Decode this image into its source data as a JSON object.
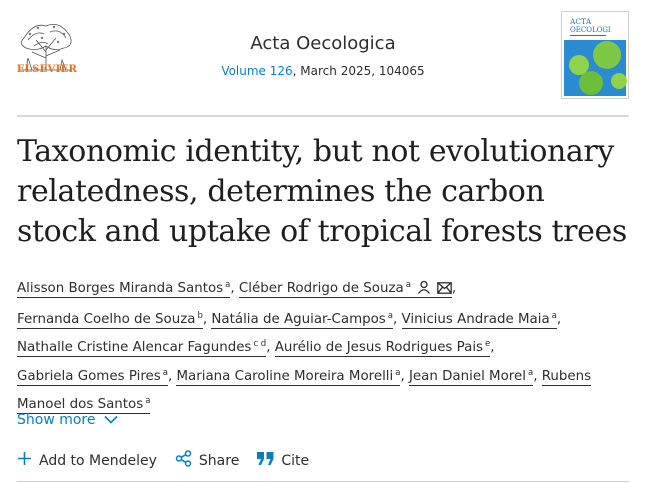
{
  "publisher": {
    "name": "ELSEVIER"
  },
  "journal": {
    "title": "Acta Oecologica",
    "volume": "Volume 126",
    "issue_info": ", March 2025, 104065",
    "cover_title_line1": "ACTA",
    "cover_title_line2": "OECOLOGI"
  },
  "article": {
    "title": "Taxonomic identity, but not evolutionary relatedness, determines the carbon stock and uptake of tropical forests trees",
    "authors": [
      {
        "name": "Alisson Borges Miranda Santos",
        "sup": "a"
      },
      {
        "name": "Cléber Rodrigo de Souza",
        "sup": "a"
      },
      {
        "name": "Fernanda Coelho de Souza",
        "sup": "b"
      },
      {
        "name": "Natália de Aguiar-Campos",
        "sup": "a"
      },
      {
        "name": "Vinicius Andrade Maia",
        "sup": "a"
      },
      {
        "name": "Nathalle Cristine Alencar Fagundes",
        "sup": "c d"
      },
      {
        "name": "Aurélio de Jesus Rodrigues Pais",
        "sup": "e"
      },
      {
        "name": "Gabriela Gomes Pires",
        "sup": "a"
      },
      {
        "name": "Mariana Caroline Moreira Morelli",
        "sup": "a"
      },
      {
        "name": "Jean Daniel Morel",
        "sup": "a"
      },
      {
        "name": "Rubens Manoel dos Santos",
        "sup": "a"
      }
    ]
  },
  "show_more": {
    "label": "Show more",
    "icon": "chevron-down-icon"
  },
  "actions": [
    {
      "label": "Add to Mendeley",
      "icon": "plus-icon"
    },
    {
      "label": "Share",
      "icon": "share-icon"
    },
    {
      "label": "Cite",
      "icon": "quote-icon"
    }
  ],
  "colors": {
    "link": "#0c7dbb",
    "publisher_orange": "#e9711c",
    "text": "#2e2e2e"
  }
}
